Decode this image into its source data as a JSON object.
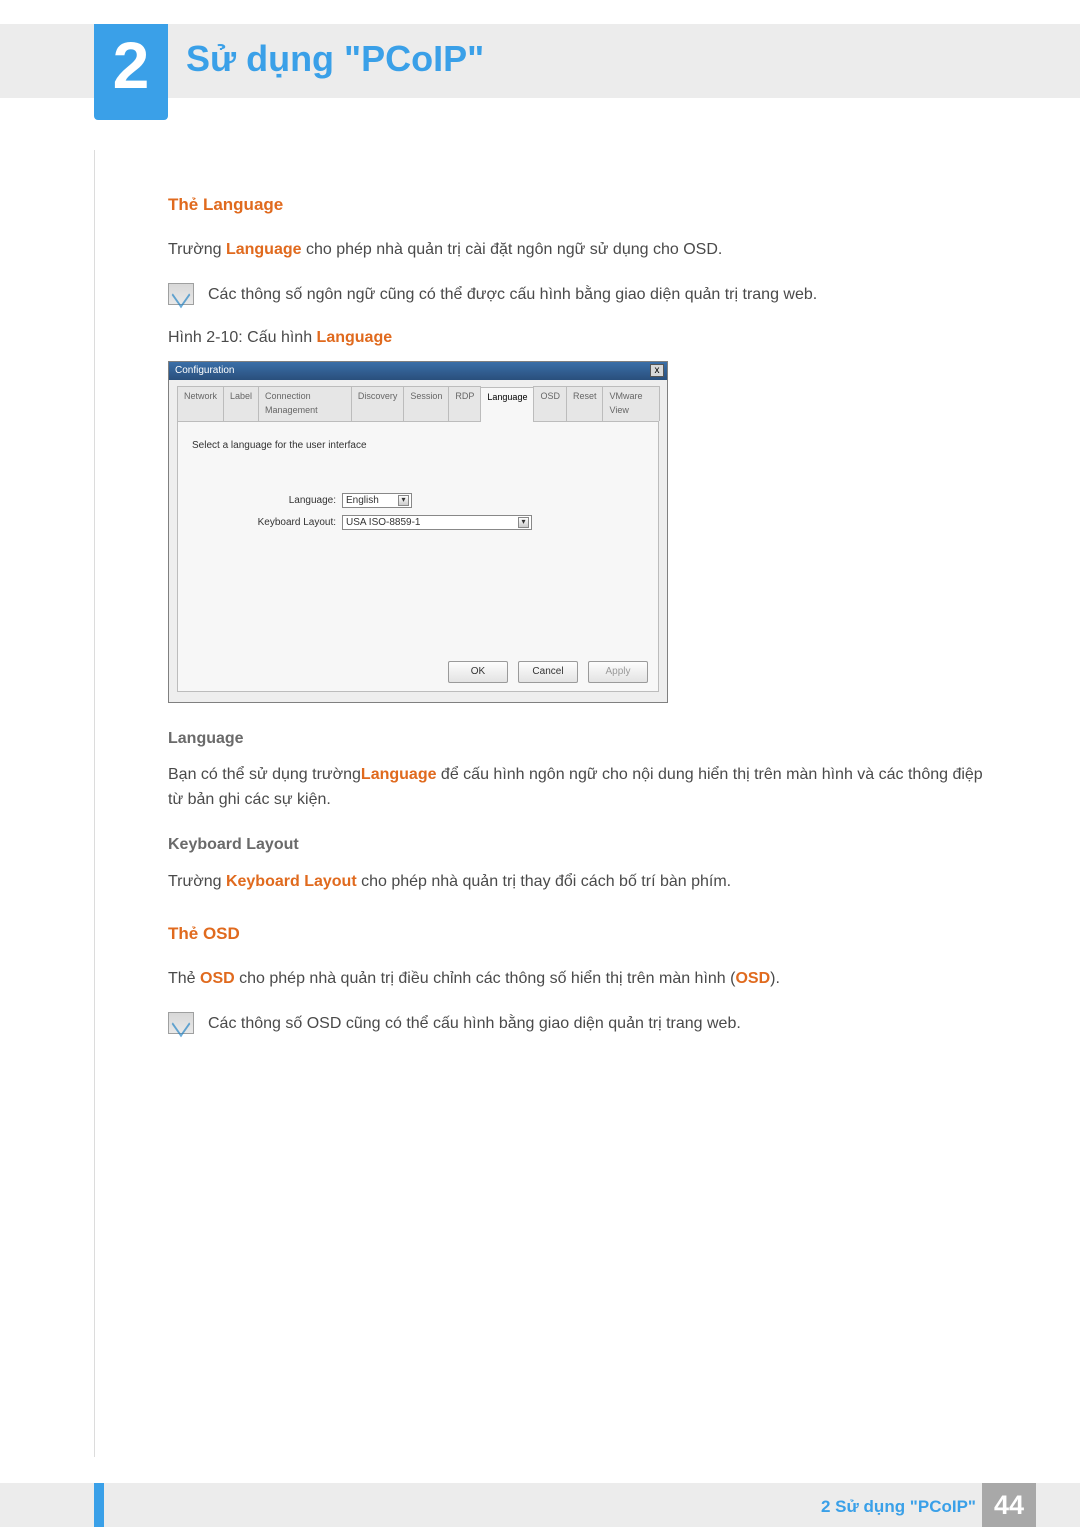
{
  "chapter": {
    "number": "2",
    "title": "Sử dụng \"PCoIP\""
  },
  "section_language": {
    "heading": "Thẻ Language",
    "p1_pre": "Trường ",
    "p1_lang": "Language",
    "p1_post": " cho phép nhà quản trị cài đặt ngôn ngữ sử dụng cho OSD.",
    "note": "Các thông số ngôn ngữ cũng có thể được cấu hình bằng giao diện quản trị trang web.",
    "fig_pre": "Hình 2-10: Cấu hình ",
    "fig_lang": "Language"
  },
  "config_window": {
    "title": "Configuration",
    "close": "x",
    "tabs": [
      "Network",
      "Label",
      "Connection Management",
      "Discovery",
      "Session",
      "RDP",
      "Language",
      "OSD",
      "Reset",
      "VMware View"
    ],
    "active_tab_index": 6,
    "desc": "Select a language for the user interface",
    "row1_label": "Language:",
    "row1_value": "English",
    "row2_label": "Keyboard Layout:",
    "row2_value": "USA ISO-8859-1",
    "btn_ok": "OK",
    "btn_cancel": "Cancel",
    "btn_apply": "Apply"
  },
  "sub_language": {
    "heading": "Language",
    "p_pre": "Bạn có thể sử dụng trường",
    "p_lang": "Language",
    "p_post": " để cấu hình ngôn ngữ cho nội dung hiển thị trên màn hình và các thông điệp từ bản ghi các sự kiện."
  },
  "sub_keyboard": {
    "heading": "Keyboard Layout",
    "p_pre": "Trường ",
    "p_bold": "Keyboard Layout",
    "p_post": " cho phép nhà quản trị thay đổi cách bố trí bàn phím."
  },
  "section_osd": {
    "heading": "Thẻ OSD",
    "p_pre": "Thẻ ",
    "p_b1": "OSD",
    "p_mid": " cho phép nhà quản trị điều chỉnh các thông số hiển thị trên màn hình (",
    "p_b2": "OSD",
    "p_post": ").",
    "note": "Các thông số OSD cũng có thể cấu hình bằng giao diện quản trị trang web."
  },
  "footer": {
    "title": "2 Sử dụng \"PCoIP\"",
    "page": "44"
  }
}
